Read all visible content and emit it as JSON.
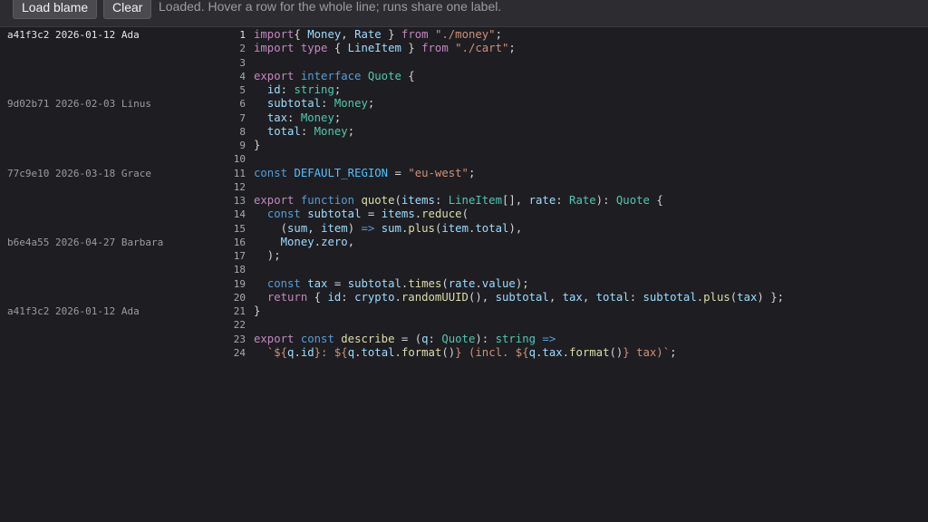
{
  "toolbar": {
    "load_label": "Load blame",
    "clear_label": "Clear",
    "status": "Loaded. Hover a row for the whole line; runs share one label."
  },
  "colors": {
    "background": "#1e1e22",
    "toolbar": "#2d2d31",
    "button": "#4a4a4f",
    "keyword": "#c586c0",
    "keyword_blue": "#569cd6",
    "type": "#4ec9b0",
    "function": "#dcdcaa",
    "string": "#ce9178",
    "variable": "#9cdcfe",
    "constant": "#4fc1ff"
  },
  "rows": [
    {
      "n": "1",
      "blame": "a41f3c2 2026-01-12 Ada",
      "current": true,
      "code": [
        [
          "kw",
          "import"
        ],
        [
          "",
          "{ "
        ],
        [
          "vr",
          "Money"
        ],
        [
          "",
          ", "
        ],
        [
          "vr",
          "Rate"
        ],
        [
          "",
          " } "
        ],
        [
          "kw",
          "from"
        ],
        [
          "",
          " "
        ],
        [
          "st",
          "\"./money\""
        ],
        [
          "",
          ";"
        ]
      ]
    },
    {
      "n": "2",
      "blame": "",
      "code": [
        [
          "kw",
          "import"
        ],
        [
          "",
          " "
        ],
        [
          "kw",
          "type"
        ],
        [
          "",
          " { "
        ],
        [
          "vr",
          "LineItem"
        ],
        [
          "",
          " } "
        ],
        [
          "kw",
          "from"
        ],
        [
          "",
          " "
        ],
        [
          "st",
          "\"./cart\""
        ],
        [
          "",
          ";"
        ]
      ]
    },
    {
      "n": "3",
      "blame": "",
      "code": []
    },
    {
      "n": "4",
      "blame": "",
      "code": [
        [
          "kw",
          "export"
        ],
        [
          "",
          " "
        ],
        [
          "kb",
          "interface"
        ],
        [
          "",
          " "
        ],
        [
          "ty",
          "Quote"
        ],
        [
          "",
          " {"
        ]
      ]
    },
    {
      "n": "5",
      "blame": "",
      "code": [
        [
          "",
          "  "
        ],
        [
          "vr",
          "id"
        ],
        [
          "",
          ": "
        ],
        [
          "ty",
          "string"
        ],
        [
          "",
          ";"
        ]
      ]
    },
    {
      "n": "6",
      "blame": "9d02b71 2026-02-03 Linus",
      "code": [
        [
          "",
          "  "
        ],
        [
          "vr",
          "subtotal"
        ],
        [
          "",
          ": "
        ],
        [
          "ty",
          "Money"
        ],
        [
          "",
          ";"
        ]
      ]
    },
    {
      "n": "7",
      "blame": "",
      "code": [
        [
          "",
          "  "
        ],
        [
          "vr",
          "tax"
        ],
        [
          "",
          ": "
        ],
        [
          "ty",
          "Money"
        ],
        [
          "",
          ";"
        ]
      ]
    },
    {
      "n": "8",
      "blame": "",
      "code": [
        [
          "",
          "  "
        ],
        [
          "vr",
          "total"
        ],
        [
          "",
          ": "
        ],
        [
          "ty",
          "Money"
        ],
        [
          "",
          ";"
        ]
      ]
    },
    {
      "n": "9",
      "blame": "",
      "code": [
        [
          "",
          "}"
        ]
      ]
    },
    {
      "n": "10",
      "blame": "",
      "code": []
    },
    {
      "n": "11",
      "blame": "77c9e10 2026-03-18 Grace",
      "code": [
        [
          "kb",
          "const"
        ],
        [
          "",
          " "
        ],
        [
          "cn",
          "DEFAULT_REGION"
        ],
        [
          "",
          " = "
        ],
        [
          "st",
          "\"eu-west\""
        ],
        [
          "",
          ";"
        ]
      ]
    },
    {
      "n": "12",
      "blame": "",
      "code": []
    },
    {
      "n": "13",
      "blame": "",
      "code": [
        [
          "kw",
          "export"
        ],
        [
          "",
          " "
        ],
        [
          "kb",
          "function"
        ],
        [
          "",
          " "
        ],
        [
          "fn",
          "quote"
        ],
        [
          "",
          "("
        ],
        [
          "vr",
          "items"
        ],
        [
          "",
          ": "
        ],
        [
          "ty",
          "LineItem"
        ],
        [
          "",
          "[], "
        ],
        [
          "vr",
          "rate"
        ],
        [
          "",
          ": "
        ],
        [
          "ty",
          "Rate"
        ],
        [
          "",
          "): "
        ],
        [
          "ty",
          "Quote"
        ],
        [
          "",
          " {"
        ]
      ]
    },
    {
      "n": "14",
      "blame": "",
      "code": [
        [
          "",
          "  "
        ],
        [
          "kb",
          "const"
        ],
        [
          "",
          " "
        ],
        [
          "vr",
          "subtotal"
        ],
        [
          "",
          " = "
        ],
        [
          "vr",
          "items"
        ],
        [
          "",
          "."
        ],
        [
          "fn",
          "reduce"
        ],
        [
          "",
          "("
        ]
      ]
    },
    {
      "n": "15",
      "blame": "",
      "code": [
        [
          "",
          "    ("
        ],
        [
          "vr",
          "sum"
        ],
        [
          "",
          ", "
        ],
        [
          "vr",
          "item"
        ],
        [
          "",
          ") "
        ],
        [
          "kb",
          "=>"
        ],
        [
          "",
          " "
        ],
        [
          "vr",
          "sum"
        ],
        [
          "",
          "."
        ],
        [
          "fn",
          "plus"
        ],
        [
          "",
          "("
        ],
        [
          "vr",
          "item"
        ],
        [
          "",
          "."
        ],
        [
          "vr",
          "total"
        ],
        [
          "",
          "),"
        ]
      ]
    },
    {
      "n": "16",
      "blame": "b6e4a55 2026-04-27 Barbara",
      "code": [
        [
          "",
          "    "
        ],
        [
          "vr",
          "Money"
        ],
        [
          "",
          "."
        ],
        [
          "vr",
          "zero"
        ],
        [
          "",
          ","
        ]
      ]
    },
    {
      "n": "17",
      "blame": "",
      "code": [
        [
          "",
          "  );"
        ]
      ]
    },
    {
      "n": "18",
      "blame": "",
      "code": []
    },
    {
      "n": "19",
      "blame": "",
      "code": [
        [
          "",
          "  "
        ],
        [
          "kb",
          "const"
        ],
        [
          "",
          " "
        ],
        [
          "vr",
          "tax"
        ],
        [
          "",
          " = "
        ],
        [
          "vr",
          "subtotal"
        ],
        [
          "",
          "."
        ],
        [
          "fn",
          "times"
        ],
        [
          "",
          "("
        ],
        [
          "vr",
          "rate"
        ],
        [
          "",
          "."
        ],
        [
          "vr",
          "value"
        ],
        [
          "",
          ");"
        ]
      ]
    },
    {
      "n": "20",
      "blame": "",
      "code": [
        [
          "",
          "  "
        ],
        [
          "kw",
          "return"
        ],
        [
          "",
          " { "
        ],
        [
          "vr",
          "id"
        ],
        [
          "",
          ": "
        ],
        [
          "vr",
          "crypto"
        ],
        [
          "",
          "."
        ],
        [
          "fn",
          "randomUUID"
        ],
        [
          "",
          "(), "
        ],
        [
          "vr",
          "subtotal"
        ],
        [
          "",
          ", "
        ],
        [
          "vr",
          "tax"
        ],
        [
          "",
          ", "
        ],
        [
          "vr",
          "total"
        ],
        [
          "",
          ": "
        ],
        [
          "vr",
          "subtotal"
        ],
        [
          "",
          "."
        ],
        [
          "fn",
          "plus"
        ],
        [
          "",
          "("
        ],
        [
          "vr",
          "tax"
        ],
        [
          "",
          ") };"
        ]
      ]
    },
    {
      "n": "21",
      "blame": "a41f3c2 2026-01-12 Ada",
      "code": [
        [
          "",
          "}"
        ]
      ]
    },
    {
      "n": "22",
      "blame": "",
      "code": []
    },
    {
      "n": "23",
      "blame": "",
      "code": [
        [
          "kw",
          "export"
        ],
        [
          "",
          " "
        ],
        [
          "kb",
          "const"
        ],
        [
          "",
          " "
        ],
        [
          "fn",
          "describe"
        ],
        [
          "",
          " = ("
        ],
        [
          "vr",
          "q"
        ],
        [
          "",
          ": "
        ],
        [
          "ty",
          "Quote"
        ],
        [
          "",
          "): "
        ],
        [
          "ty",
          "string"
        ],
        [
          "",
          " "
        ],
        [
          "kb",
          "=>"
        ]
      ]
    },
    {
      "n": "24",
      "blame": "",
      "code": [
        [
          "",
          "  "
        ],
        [
          "st",
          "`${"
        ],
        [
          "vr",
          "q"
        ],
        [
          "",
          "."
        ],
        [
          "vr",
          "id"
        ],
        [
          "st",
          "}: ${"
        ],
        [
          "vr",
          "q"
        ],
        [
          "",
          "."
        ],
        [
          "vr",
          "total"
        ],
        [
          "",
          "."
        ],
        [
          "fn",
          "format"
        ],
        [
          "",
          "()"
        ],
        [
          "st",
          "} (incl. ${"
        ],
        [
          "vr",
          "q"
        ],
        [
          "",
          "."
        ],
        [
          "vr",
          "tax"
        ],
        [
          "",
          "."
        ],
        [
          "fn",
          "format"
        ],
        [
          "",
          "()"
        ],
        [
          "st",
          "} tax)`"
        ],
        [
          "",
          ";"
        ]
      ]
    }
  ]
}
